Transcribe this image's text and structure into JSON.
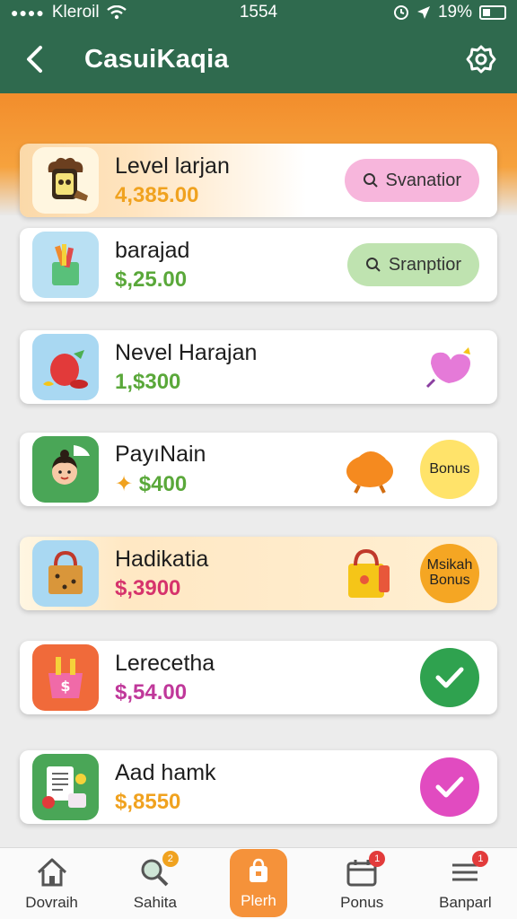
{
  "status_bar": {
    "carrier": "Kleroil",
    "time": "1554",
    "battery": "19%"
  },
  "header": {
    "title": "CasuiKaqia"
  },
  "items": [
    {
      "name": "Level larjan",
      "price": "4,385.00",
      "price_color": "#f0a21f",
      "action": "Svanatior",
      "action_color": "#f7b6dc"
    },
    {
      "name": "barajad",
      "price": "$,25.00",
      "price_color": "#5aa83a",
      "action": "Sranptior",
      "action_color": "#bfe3b0"
    },
    {
      "name": "Nevel Harajan",
      "price": "1,$300",
      "price_color": "#5aa83a"
    },
    {
      "name": "PayıNain",
      "price": "$400",
      "price_color": "#5aa83a",
      "action": "Bonus",
      "action_color": "#ffe36a"
    },
    {
      "name": "Hadikatia",
      "price": "$,3900",
      "price_color": "#d6336c",
      "action_line1": "Msikah",
      "action_line2": "Bonus",
      "action_color": "#f5a623"
    },
    {
      "name": "Lerecetha",
      "price": "$,54.00",
      "price_color": "#c0389a",
      "action_color": "#2fa24f"
    },
    {
      "name": "Aad hamk",
      "price": "$,8550",
      "price_color": "#f0a21f",
      "action_color": "#e14bc0"
    }
  ],
  "tabs": [
    {
      "label": "Dovraih",
      "icon": "home-icon"
    },
    {
      "label": "Sahita",
      "icon": "search-icon",
      "badge": "2"
    },
    {
      "label": "Plerh",
      "icon": "bag-icon"
    },
    {
      "label": "Ponus",
      "icon": "calendar-icon",
      "badge": "1"
    },
    {
      "label": "Banparl",
      "icon": "menu-icon",
      "badge": "1"
    }
  ]
}
